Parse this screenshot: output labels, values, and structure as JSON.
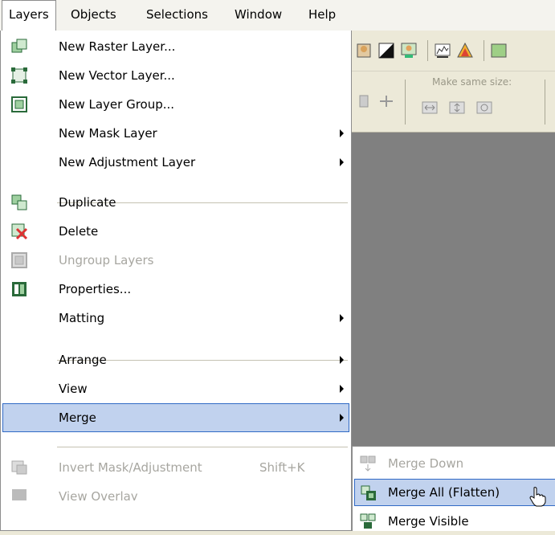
{
  "menubar": {
    "items": [
      {
        "label": "Layers",
        "accel": "L"
      },
      {
        "label": "Objects",
        "accel": "O"
      },
      {
        "label": "Selections",
        "accel": "S"
      },
      {
        "label": "Window",
        "accel": "W"
      },
      {
        "label": "Help",
        "accel": "H"
      }
    ]
  },
  "toolbar": {
    "make_same_size_label": "Make same size:"
  },
  "layers_menu": {
    "new_raster_layer": "New Raster Layer...",
    "new_vector_layer": "New Vector Layer...",
    "new_layer_group": "New Layer Group...",
    "new_mask_layer": "New Mask Layer",
    "new_adjustment_layer": "New Adjustment Layer",
    "duplicate": "Duplicate",
    "delete": "Delete",
    "ungroup_layers": "Ungroup Layers",
    "properties": "Properties...",
    "matting": "Matting",
    "arrange": "Arrange",
    "view": "View",
    "merge": "Merge",
    "invert_mask": "Invert Mask/Adjustment",
    "invert_mask_shortcut": "Shift+K",
    "view_overlay": "View Overlay"
  },
  "merge_submenu": {
    "merge_down": "Merge Down",
    "merge_all": "Merge All (Flatten)",
    "merge_visible": "Merge Visible"
  },
  "colors": {
    "highlight_bg": "#c1d2ee",
    "highlight_border": "#316ac5",
    "disabled_text": "#a7a6a0",
    "workspace": "#808080"
  }
}
